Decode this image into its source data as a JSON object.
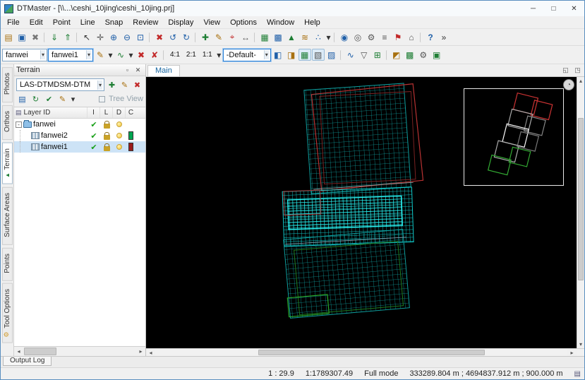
{
  "window": {
    "title": "DTMaster - [\\\\...\\ceshi_10jing\\ceshi_10jing.prj]"
  },
  "glyphs": {
    "caret": "▾",
    "up": "▴",
    "down": "▾",
    "left": "◂",
    "right": "▸",
    "minimize": "─",
    "maximize": "□",
    "close": "✕",
    "pin": "▫",
    "check": "✔",
    "expander": "-",
    "overview_toggle": "◔",
    "copy": "▤",
    "undock": "◱",
    "maximize_view": "◳",
    "overflow": "»"
  },
  "menu": {
    "items": [
      {
        "name": "menu-item-file",
        "label": "File"
      },
      {
        "name": "menu-item-edit",
        "label": "Edit"
      },
      {
        "name": "menu-item-point",
        "label": "Point"
      },
      {
        "name": "menu-item-line",
        "label": "Line"
      },
      {
        "name": "menu-item-snap",
        "label": "Snap"
      },
      {
        "name": "menu-item-review",
        "label": "Review"
      },
      {
        "name": "menu-item-display",
        "label": "Display"
      },
      {
        "name": "menu-item-view",
        "label": "View"
      },
      {
        "name": "menu-item-options",
        "label": "Options"
      },
      {
        "name": "menu-item-window",
        "label": "Window"
      },
      {
        "name": "menu-item-help",
        "label": "Help"
      }
    ]
  },
  "toolbar1": {
    "icons": [
      {
        "name": "open-project-icon",
        "glyph": "▤",
        "style": "color:#a8700f"
      },
      {
        "name": "save-project-icon",
        "glyph": "▣",
        "style": "color:#1f5fa8"
      },
      {
        "name": "close-project-icon",
        "glyph": "✖",
        "style": "color:#777777"
      },
      {
        "name": "toolbar-separator",
        "glyph": "",
        "style": "width:3px;border-left:1px solid #c9c9c9;height:14px;margin:0 2px",
        "inter": "false"
      },
      {
        "name": "import-data-icon",
        "glyph": "⇓",
        "style": "color:#1e7e34"
      },
      {
        "name": "export-data-icon",
        "glyph": "⇑",
        "style": "color:#1e7e34"
      },
      {
        "name": "toolbar-separator",
        "glyph": "",
        "style": "width:3px;border-left:1px solid #c9c9c9;height:14px;margin:0 2px",
        "inter": "false"
      },
      {
        "name": "select-tool-icon",
        "glyph": "↖",
        "style": "color:#333333"
      },
      {
        "name": "pan-tool-icon",
        "glyph": "✛",
        "style": "color:#555555"
      },
      {
        "name": "zoom-in-icon",
        "glyph": "⊕",
        "style": "color:#1f5fa8"
      },
      {
        "name": "zoom-out-icon",
        "glyph": "⊖",
        "style": "color:#1f5fa8"
      },
      {
        "name": "zoom-extents-icon",
        "glyph": "⊡",
        "style": "color:#1f5fa8"
      },
      {
        "name": "toolbar-separator",
        "glyph": "",
        "style": "width:3px;border-left:1px solid #c9c9c9;height:14px;margin:0 2px",
        "inter": "false"
      },
      {
        "name": "delete-icon",
        "glyph": "✖",
        "style": "color:#c22929"
      },
      {
        "name": "undo-icon",
        "glyph": "↺",
        "style": "color:#1f5fa8"
      },
      {
        "name": "redo-icon",
        "glyph": "↻",
        "style": "color:#1f5fa8"
      },
      {
        "name": "toolbar-separator",
        "glyph": "",
        "style": "width:3px;border-left:1px solid #c9c9c9;height:14px;margin:0 2px",
        "inter": "false"
      },
      {
        "name": "add-point-icon",
        "glyph": "✚",
        "style": "color:#1e7e34"
      },
      {
        "name": "edit-point-icon",
        "glyph": "✎",
        "style": "color:#a8700f"
      },
      {
        "name": "snap-marker-icon",
        "glyph": "⌖",
        "style": "color:#c22929"
      },
      {
        "name": "measure-icon",
        "glyph": "↔",
        "style": "color:#555555"
      },
      {
        "name": "toolbar-separator",
        "glyph": "",
        "style": "width:3px;border-left:1px solid #c9c9c9;height:14px;margin:0 2px",
        "inter": "false"
      },
      {
        "name": "grid-display-icon",
        "glyph": "▦",
        "style": "color:#1e7e34"
      },
      {
        "name": "mesh-display-icon",
        "glyph": "▩",
        "style": "color:#1f5fa8"
      },
      {
        "name": "terrain-display-icon",
        "glyph": "▲",
        "style": "color:#1e7e34"
      },
      {
        "name": "contour-display-icon",
        "glyph": "≋",
        "style": "color:#a8700f"
      },
      {
        "name": "point-cloud-icon",
        "glyph": "∴",
        "style": "color:#1f5fa8"
      },
      {
        "name": "display-caret-icon",
        "glyph": "▾",
        "style": "color:#333333;width:9px"
      },
      {
        "name": "toolbar-separator",
        "glyph": "",
        "style": "width:3px;border-left:1px solid #c9c9c9;height:14px;margin:0 2px",
        "inter": "false"
      },
      {
        "name": "stereo-view-icon",
        "glyph": "◉",
        "style": "color:#1f5fa8"
      },
      {
        "name": "mono-view-icon",
        "glyph": "◎",
        "style": "color:#555555"
      },
      {
        "name": "settings-gear-icon",
        "glyph": "⚙",
        "style": "color:#555555"
      },
      {
        "name": "layer-list-icon",
        "glyph": "≡",
        "style": "color:#555555"
      },
      {
        "name": "flag-icon",
        "glyph": "⚑",
        "style": "color:#c22929"
      },
      {
        "name": "home-view-icon",
        "glyph": "⌂",
        "style": "color:#555555"
      },
      {
        "name": "toolbar-separator",
        "glyph": "",
        "style": "width:3px;border-left:1px solid #c9c9c9;height:14px;margin:0 2px",
        "inter": "false"
      },
      {
        "name": "help-icon",
        "glyph": "?",
        "style": "color:#1f5fa8;font-weight:bold"
      },
      {
        "name": "toolbar-overflow-icon",
        "glyph": "»",
        "style": "color:#333333"
      }
    ]
  },
  "toolbar2": {
    "combo1": {
      "value": "fanwei"
    },
    "combo2": {
      "value": "fanwei1"
    },
    "icons_a": [
      {
        "name": "edit-boundary-icon",
        "glyph": "✎",
        "style": "color:#a8700f"
      },
      {
        "name": "edit-boundary-caret-icon",
        "glyph": "▾",
        "style": "color:#333333;width:9px"
      },
      {
        "name": "draw-polyline-icon",
        "glyph": "∿",
        "style": "color:#1e7e34"
      },
      {
        "name": "draw-polyline-caret-icon",
        "glyph": "▾",
        "style": "color:#333333;width:9px"
      },
      {
        "name": "delete-feature-icon",
        "glyph": "✖",
        "style": "color:#c22929"
      },
      {
        "name": "delete-all-icon",
        "glyph": "✘",
        "style": "color:#c22929"
      },
      {
        "name": "toolbar-separator",
        "glyph": "",
        "style": "width:3px;border-left:1px solid #c9c9c9;height:14px;margin:0 2px",
        "inter": "false"
      }
    ],
    "ratios": [
      "4:1",
      "2:1",
      "1:1"
    ],
    "combo_default": {
      "value": "-Default-"
    },
    "icons_b": [
      {
        "name": "interpolation-icon",
        "glyph": "◧",
        "style": "color:#1f5fa8"
      },
      {
        "name": "hillshade-icon",
        "glyph": "◨",
        "style": "color:#a8700f"
      },
      {
        "name": "grid-toggle-icon",
        "glyph": "▦",
        "style": "color:#1e7e34;background:#dcebf7;border:1px solid #9bbcd8"
      },
      {
        "name": "tin-toggle-icon",
        "glyph": "▧",
        "style": "color:#555555;background:#dcebf7;border:1px solid #9bbcd8"
      },
      {
        "name": "dtm-toggle-icon",
        "glyph": "▨",
        "style": "color:#1f5fa8"
      },
      {
        "name": "toolbar-separator",
        "glyph": "",
        "style": "width:3px;border-left:1px solid #c9c9c9;height:14px;margin:0 2px",
        "inter": "false"
      },
      {
        "name": "smooth-tool-icon",
        "glyph": "∿",
        "style": "color:#1f5fa8"
      },
      {
        "name": "filter-tool-icon",
        "glyph": "▽",
        "style": "color:#555555"
      },
      {
        "name": "classify-tool-icon",
        "glyph": "⊞",
        "style": "color:#1e7e34"
      },
      {
        "name": "toolbar-separator",
        "glyph": "",
        "style": "width:3px;border-left:1px solid #c9c9c9;height:14px;margin:0 2px",
        "inter": "false"
      },
      {
        "name": "shading-icon",
        "glyph": "◩",
        "style": "color:#a8700f"
      },
      {
        "name": "texture-icon",
        "glyph": "▩",
        "style": "color:#1e7e34"
      },
      {
        "name": "view-gear-icon",
        "glyph": "⚙",
        "style": "color:#555555"
      },
      {
        "name": "screenshot-icon",
        "glyph": "▣",
        "style": "color:#1e7e34"
      }
    ]
  },
  "side_tabs": {
    "items": [
      {
        "name": "sidebar-tab-photos",
        "label": "Photos"
      },
      {
        "name": "sidebar-tab-orthos",
        "label": "Orthos"
      },
      {
        "name": "sidebar-tab-terrain",
        "label": "Terrain",
        "active": "true",
        "icon": "▲",
        "icon_style": "color:#1e7e34;font-size:8px"
      },
      {
        "name": "sidebar-tab-surface-areas",
        "label": "Surface Areas"
      },
      {
        "name": "sidebar-tab-points",
        "label": "Points"
      },
      {
        "name": "sidebar-tab-tool-options",
        "label": "Tool Options",
        "icon": "⚙",
        "icon_style": "color:#d09a2a;font-size:9px"
      }
    ]
  },
  "terrain_panel": {
    "title": "Terrain",
    "combo": {
      "value": "LAS-DTMDSM-DTM"
    },
    "combo_buttons": [
      {
        "name": "add-terrain-icon",
        "glyph": "✚",
        "style": "color:#1e7e34"
      },
      {
        "name": "edit-terrain-icon",
        "glyph": "✎",
        "style": "color:#a8700f"
      },
      {
        "name": "delete-terrain-icon",
        "glyph": "✖",
        "style": "color:#c22929"
      }
    ],
    "tools": [
      {
        "name": "save-edits-icon",
        "glyph": "▤",
        "style": "color:#1f5fa8"
      },
      {
        "name": "refresh-layers-icon",
        "glyph": "↻",
        "style": "color:#1e7e34"
      },
      {
        "name": "validate-layers-icon",
        "glyph": "✔",
        "style": "color:#1e7e34"
      },
      {
        "name": "edit-attributes-icon",
        "glyph": "✎",
        "style": "color:#a8700f"
      },
      {
        "name": "layer-tools-caret-icon",
        "glyph": "▾",
        "style": "color:#333333;width:9px"
      }
    ],
    "tree_view_label": "Tree View",
    "columns": {
      "layer": "Layer ID",
      "i": "I",
      "l": "L",
      "d": "D",
      "c": "C"
    },
    "rows": [
      {
        "name": "fanwei"
      },
      {
        "name": "fanwei2",
        "swatch_style": "background:#00a550"
      },
      {
        "name": "fanwei1",
        "swatch_style": "background:#9b1c1c"
      }
    ]
  },
  "main_view": {
    "tab": "Main"
  },
  "output_log": {
    "label": "Output Log"
  },
  "statusbar": {
    "scale": "1 : 29.9",
    "map_scale": "1:1789307.49",
    "mode": "Full mode",
    "coords": "333289.804 m ; 4694837.912 m ; 900.000 m"
  }
}
